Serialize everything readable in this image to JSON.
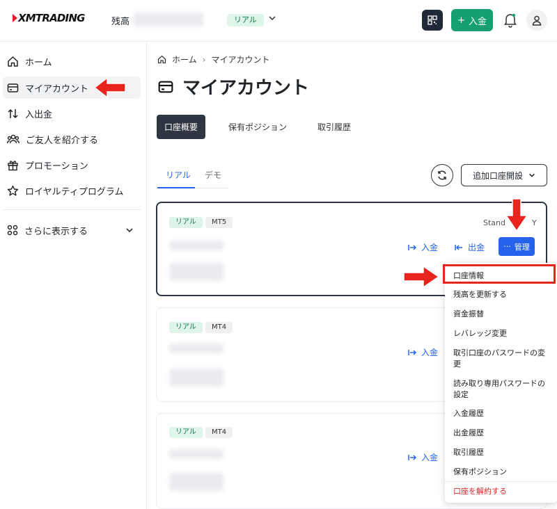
{
  "header": {
    "logo_text": "XMTRADING",
    "balance_label": "残高",
    "account_type_badge": "リアル",
    "deposit_button": "入金"
  },
  "sidebar": {
    "items": [
      {
        "label": "ホーム",
        "icon": "home-icon"
      },
      {
        "label": "マイアカウント",
        "icon": "wallet-icon",
        "active": true
      },
      {
        "label": "入出金",
        "icon": "transfer-icon"
      },
      {
        "label": "ご友人を紹介する",
        "icon": "users-icon"
      },
      {
        "label": "プロモーション",
        "icon": "gift-icon"
      },
      {
        "label": "ロイヤルティプログラム",
        "icon": "star-icon"
      }
    ],
    "more_label": "さらに表示する"
  },
  "breadcrumb": {
    "home": "ホーム",
    "current": "マイアカウント"
  },
  "page_title": "マイアカウント",
  "tabs": [
    {
      "label": "口座概要",
      "active": true
    },
    {
      "label": "保有ポジション"
    },
    {
      "label": "取引履歴"
    }
  ],
  "subtabs": [
    {
      "label": "リアル",
      "active": true
    },
    {
      "label": "デモ"
    }
  ],
  "open_account_button": "追加口座開設",
  "accounts": [
    {
      "type": "リアル",
      "platform": "MT5",
      "plan_text": "Stand",
      "plan_suffix": "Y",
      "deposit": "入金",
      "withdraw": "出金",
      "manage": "管理"
    },
    {
      "type": "リアル",
      "platform": "MT4",
      "deposit": "入金"
    },
    {
      "type": "リアル",
      "platform": "MT4",
      "deposit": "入金"
    }
  ],
  "manage_menu": {
    "items": [
      "口座情報",
      "残高を更新する",
      "資金振替",
      "レバレッジ変更",
      "取引口座のパスワードの変更",
      "読み取り専用パスワードの設定",
      "入金履歴",
      "出金履歴",
      "取引履歴",
      "保有ポジション"
    ],
    "danger_item": "口座を解約する"
  },
  "colors": {
    "accent_green": "#16a071",
    "primary_blue": "#2563eb",
    "annotation_red": "#e8241c",
    "dark": "#2f3542"
  }
}
